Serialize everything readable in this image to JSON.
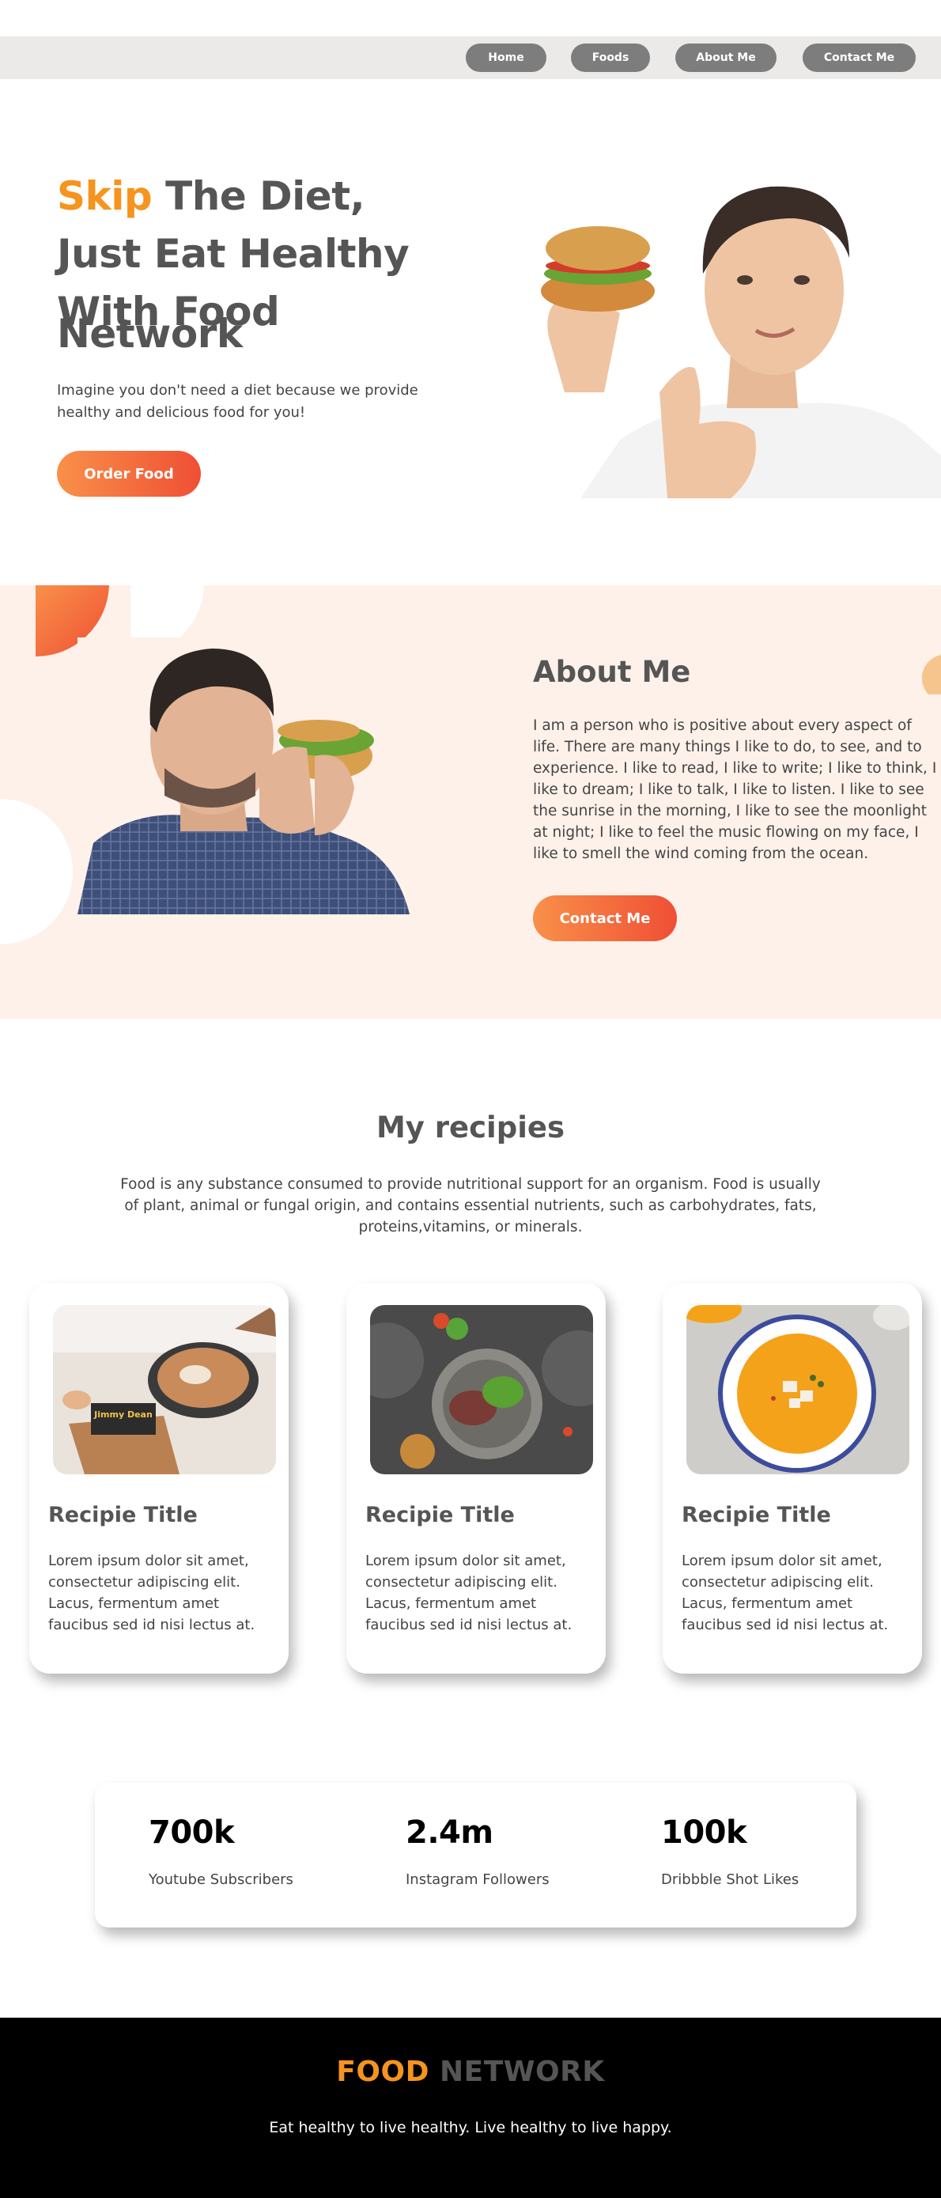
{
  "nav": {
    "items": [
      {
        "label": "Home"
      },
      {
        "label": "Foods"
      },
      {
        "label": "About Me"
      },
      {
        "label": "Contact Me"
      }
    ]
  },
  "hero": {
    "title_accent": "Skip",
    "title_rest": "The Diet,",
    "title_line2": "Just Eat Healthy",
    "title_line3": "With Food",
    "title_line4": "Network",
    "subtitle": "Imagine you don't need a diet because we provide healthy and delicious food for you!",
    "cta_label": "Order Food"
  },
  "about": {
    "title": "About Me",
    "text": "I am a person who is positive about every aspect of life. There are many things I like to do, to see, and to experience. I like to read, I like to write; I like to think, I like to dream; I like to talk, I like to listen. I like to see the sunrise in the morning, I like to see the moonlight at night; I like to feel the music flowing on my face, I like to smell the wind coming from the ocean.",
    "cta_label": "Contact Me"
  },
  "recipes": {
    "title": "My recipies",
    "intro": "Food is any substance consumed to provide nutritional support for an organism. Food is usually of plant, animal or fungal origin, and contains essential nutrients, such as carbohydrates, fats, proteins,vitamins, or minerals.",
    "cards": [
      {
        "title": "Recipie Title",
        "text": "Lorem ipsum dolor sit amet, consectetur adipiscing elit. Lacus, fermentum amet faucibus sed id nisi lectus at.",
        "label": "Jimmy Dean"
      },
      {
        "title": "Recipie Title",
        "text": "Lorem ipsum dolor sit amet, consectetur adipiscing elit. Lacus, fermentum amet faucibus sed id nisi lectus at."
      },
      {
        "title": "Recipie Title",
        "text": "Lorem ipsum dolor sit amet, consectetur adipiscing elit. Lacus, fermentum amet faucibus sed id nisi lectus at."
      }
    ]
  },
  "stats": [
    {
      "value": "700k",
      "label": "Youtube Subscribers"
    },
    {
      "value": "2.4m",
      "label": "Instagram Followers"
    },
    {
      "value": "100k",
      "label": "Dribbble Shot Likes"
    }
  ],
  "footer": {
    "brand_part1": "FOOD",
    "brand_part2": "NETWORK",
    "tagline": "Eat healthy to live healthy. Live healthy to live happy."
  },
  "colors": {
    "accent": "#f5941e",
    "gradient_start": "#f99049",
    "gradient_end": "#ef4f35",
    "nav_bg": "#ebeae8",
    "nav_button": "#7d7d7d",
    "about_bg": "#fdf1ea",
    "footer_bg": "#000000"
  }
}
